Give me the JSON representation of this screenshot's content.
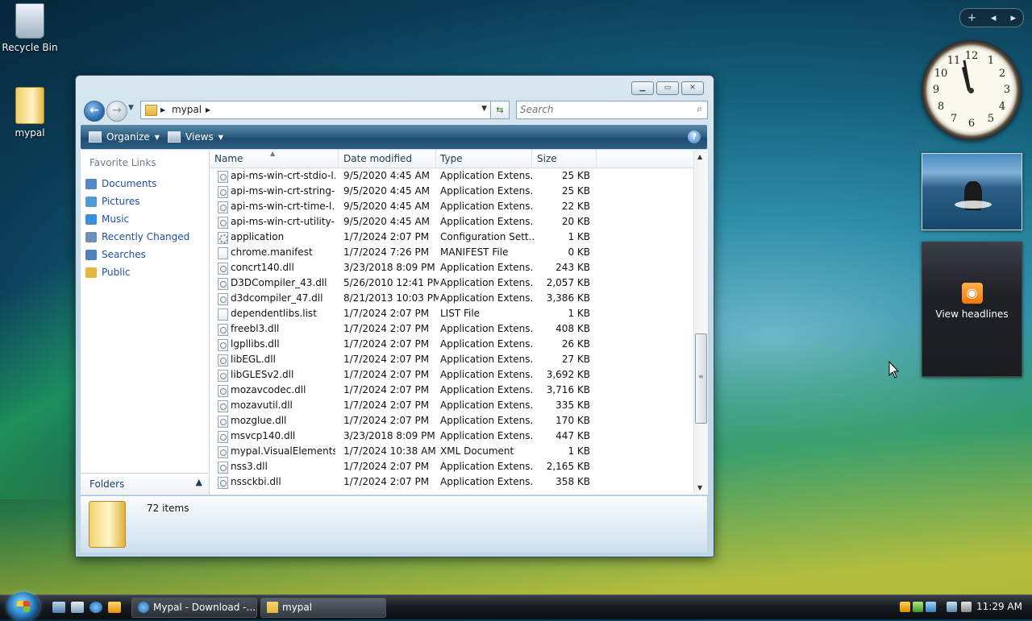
{
  "desktop": {
    "icons": [
      {
        "label": "Recycle Bin"
      },
      {
        "label": "mypal"
      }
    ]
  },
  "gadgets": {
    "toolbar": {
      "add": "+",
      "prev": "◂",
      "next": "▸"
    },
    "clock_numbers": [
      "12",
      "1",
      "2",
      "3",
      "4",
      "5",
      "6",
      "7",
      "8",
      "9",
      "10",
      "11"
    ],
    "feeds_label": "View headlines"
  },
  "window": {
    "caption": {
      "minimize": "▁",
      "maximize": "▭",
      "close": "✕"
    },
    "address": {
      "sep1": "▸",
      "folder": "mypal",
      "sep2": "▸"
    },
    "search_placeholder": "Search",
    "toolbar": {
      "organize": "Organize",
      "views": "Views"
    },
    "left_pane": {
      "title": "Favorite Links",
      "links": [
        {
          "label": "Documents",
          "color": "#5a86c8"
        },
        {
          "label": "Pictures",
          "color": "#4f9bd3"
        },
        {
          "label": "Music",
          "color": "#3b8fd8"
        },
        {
          "label": "Recently Changed",
          "color": "#6f8fb3"
        },
        {
          "label": "Searches",
          "color": "#4f81b9"
        },
        {
          "label": "Public",
          "color": "#e6b73f"
        }
      ],
      "folders_label": "Folders"
    },
    "columns": {
      "name": "Name",
      "date": "Date modified",
      "type": "Type",
      "size": "Size"
    },
    "files": [
      {
        "name": "api-ms-win-crt-stdio-l...",
        "date": "9/5/2020 4:45 AM",
        "type": "Application Extens...",
        "size": "25 KB",
        "icon": "dll"
      },
      {
        "name": "api-ms-win-crt-string-...",
        "date": "9/5/2020 4:45 AM",
        "type": "Application Extens...",
        "size": "25 KB",
        "icon": "dll"
      },
      {
        "name": "api-ms-win-crt-time-l...",
        "date": "9/5/2020 4:45 AM",
        "type": "Application Extens...",
        "size": "22 KB",
        "icon": "dll"
      },
      {
        "name": "api-ms-win-crt-utility-...",
        "date": "9/5/2020 4:45 AM",
        "type": "Application Extens...",
        "size": "20 KB",
        "icon": "dll"
      },
      {
        "name": "application",
        "date": "1/7/2024 2:07 PM",
        "type": "Configuration Sett...",
        "size": "1 KB",
        "icon": "cfg"
      },
      {
        "name": "chrome.manifest",
        "date": "1/7/2024 7:26 PM",
        "type": "MANIFEST File",
        "size": "0 KB",
        "icon": "file"
      },
      {
        "name": "concrt140.dll",
        "date": "3/23/2018 8:09 PM",
        "type": "Application Extens...",
        "size": "243 KB",
        "icon": "dll"
      },
      {
        "name": "D3DCompiler_43.dll",
        "date": "5/26/2010 12:41 PM",
        "type": "Application Extens...",
        "size": "2,057 KB",
        "icon": "dll"
      },
      {
        "name": "d3dcompiler_47.dll",
        "date": "8/21/2013 10:03 PM",
        "type": "Application Extens...",
        "size": "3,386 KB",
        "icon": "dll"
      },
      {
        "name": "dependentlibs.list",
        "date": "1/7/2024 2:07 PM",
        "type": "LIST File",
        "size": "1 KB",
        "icon": "file"
      },
      {
        "name": "freebl3.dll",
        "date": "1/7/2024 2:07 PM",
        "type": "Application Extens...",
        "size": "408 KB",
        "icon": "dll"
      },
      {
        "name": "lgpllibs.dll",
        "date": "1/7/2024 2:07 PM",
        "type": "Application Extens...",
        "size": "26 KB",
        "icon": "dll"
      },
      {
        "name": "libEGL.dll",
        "date": "1/7/2024 2:07 PM",
        "type": "Application Extens...",
        "size": "27 KB",
        "icon": "dll"
      },
      {
        "name": "libGLESv2.dll",
        "date": "1/7/2024 2:07 PM",
        "type": "Application Extens...",
        "size": "3,692 KB",
        "icon": "dll"
      },
      {
        "name": "mozavcodec.dll",
        "date": "1/7/2024 2:07 PM",
        "type": "Application Extens...",
        "size": "3,716 KB",
        "icon": "dll"
      },
      {
        "name": "mozavutil.dll",
        "date": "1/7/2024 2:07 PM",
        "type": "Application Extens...",
        "size": "335 KB",
        "icon": "dll"
      },
      {
        "name": "mozglue.dll",
        "date": "1/7/2024 2:07 PM",
        "type": "Application Extens...",
        "size": "170 KB",
        "icon": "dll"
      },
      {
        "name": "msvcp140.dll",
        "date": "3/23/2018 8:09 PM",
        "type": "Application Extens...",
        "size": "447 KB",
        "icon": "dll"
      },
      {
        "name": "mypal.VisualElements...",
        "date": "1/7/2024 10:38 AM",
        "type": "XML Document",
        "size": "1 KB",
        "icon": "dll"
      },
      {
        "name": "nss3.dll",
        "date": "1/7/2024 2:07 PM",
        "type": "Application Extens...",
        "size": "2,165 KB",
        "icon": "dll"
      },
      {
        "name": "nssckbi.dll",
        "date": "1/7/2024 2:07 PM",
        "type": "Application Extens...",
        "size": "358 KB",
        "icon": "dll"
      }
    ],
    "details": {
      "count": "72 items"
    }
  },
  "taskbar": {
    "buttons": [
      {
        "label": "Mypal - Download -...",
        "icon": "ie-icon"
      },
      {
        "label": "mypal",
        "icon": "folder-icon"
      }
    ],
    "clock": "11:29 AM"
  }
}
